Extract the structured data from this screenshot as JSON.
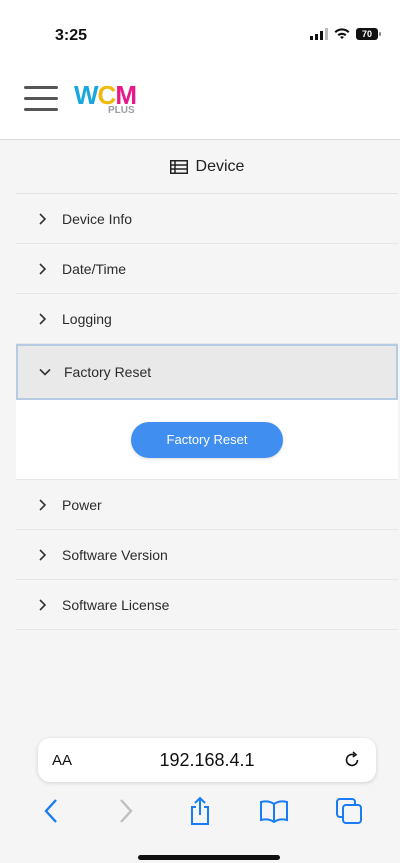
{
  "status": {
    "time": "3:25",
    "battery": "70"
  },
  "logo": {
    "main_w": "W",
    "main_c": "C",
    "main_m": "M",
    "sub": "PLUS"
  },
  "section": {
    "title": "Device"
  },
  "menu": {
    "items": [
      {
        "label": "Device Info"
      },
      {
        "label": "Date/Time"
      },
      {
        "label": "Logging"
      },
      {
        "label": "Factory Reset"
      },
      {
        "label": "Power"
      },
      {
        "label": "Software Version"
      },
      {
        "label": "Software License"
      }
    ],
    "expanded_button": "Factory Reset"
  },
  "browser": {
    "aa": "AA",
    "url": "192.168.4.1"
  },
  "colors": {
    "accent": "#3f8ef0",
    "logo_w": "#19a7e0",
    "logo_c": "#f0b90b",
    "logo_m": "#e8178a",
    "ios_blue": "#1a7cf2"
  }
}
